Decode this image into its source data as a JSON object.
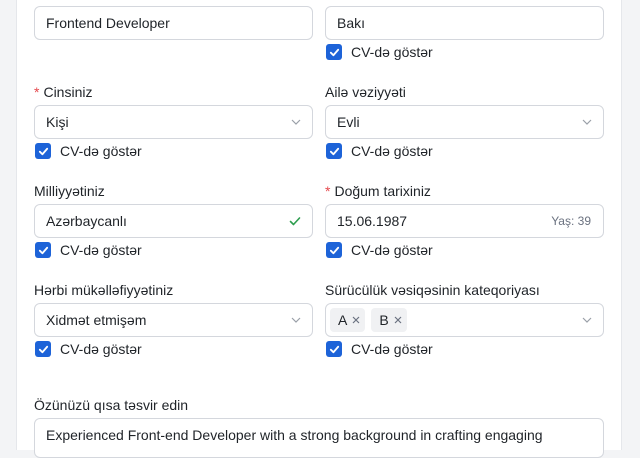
{
  "position": {
    "value": "Frontend Developer"
  },
  "city": {
    "value": "Bakı",
    "cv_label": "CV-də göstər"
  },
  "gender": {
    "label": "Cinsiniz",
    "value": "Kişi",
    "cv_label": "CV-də göstər"
  },
  "marital": {
    "label": "Ailə vəziyyəti",
    "value": "Evli",
    "cv_label": "CV-də göstər"
  },
  "nationality": {
    "label": "Milliyyətiniz",
    "value": "Azərbaycanlı",
    "cv_label": "CV-də göstər"
  },
  "birth": {
    "label": "Doğum tarixiniz",
    "value": "15.06.1987",
    "age": "Yaş: 39",
    "cv_label": "CV-də göstər"
  },
  "military": {
    "label": "Hərbi mükəlləfiyyətiniz",
    "value": "Xidmət etmişəm",
    "cv_label": "CV-də göstər"
  },
  "license": {
    "label": "Sürücülük vəsiqəsinin kateqoriyası",
    "tags": [
      "A",
      "B"
    ],
    "cv_label": "CV-də göstər"
  },
  "about": {
    "label": "Özünüzü qısa təsvir edin",
    "value": "Experienced Front-end Developer with a strong background in crafting engaging"
  },
  "colors": {
    "accent": "#1d63d8",
    "required": "#e5484d",
    "valid": "#2e9e4f"
  }
}
